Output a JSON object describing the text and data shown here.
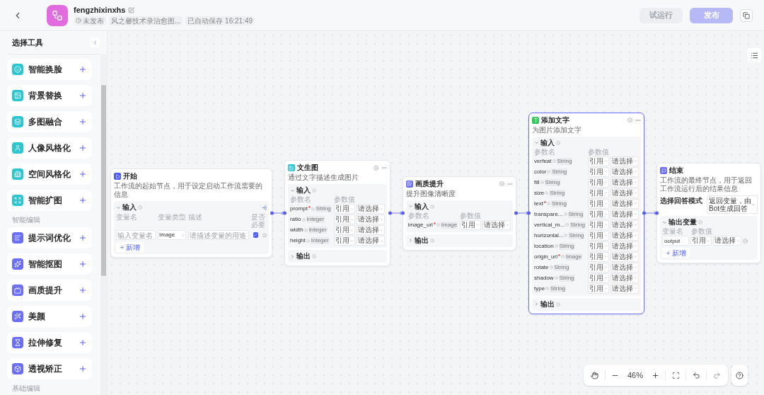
{
  "topbar": {
    "title": "fengzhixinxhs",
    "status": "未发布",
    "description": "风之馨技术录治愈图...",
    "autosave": "已自动保存 16:21:49",
    "buttons": [
      {
        "label": "试运行",
        "kind": "secondary",
        "disabled": true
      },
      {
        "label": "发布",
        "kind": "primary",
        "disabled": true
      }
    ]
  },
  "sidebar": {
    "title": "选择工具",
    "groups": [
      {
        "items": [
          {
            "label": "智能换脸",
            "color": "#2ec5d3"
          },
          {
            "label": "背景替换",
            "color": "#2ec5d3"
          },
          {
            "label": "多图融合",
            "color": "#2ec5d3"
          },
          {
            "label": "人像风格化",
            "color": "#2ec5d3"
          },
          {
            "label": "空间风格化",
            "color": "#2ec5d3"
          },
          {
            "label": "智能扩图",
            "color": "#2ec5d3"
          }
        ]
      },
      {
        "heading": "智能编辑",
        "items": [
          {
            "label": "提示词优化",
            "color": "#6b6ef7"
          },
          {
            "label": "智能抠图",
            "color": "#6b6ef7"
          },
          {
            "label": "画质提升",
            "color": "#6b6ef7"
          },
          {
            "label": "美颜",
            "color": "#6b6ef7"
          },
          {
            "label": "拉伸修复",
            "color": "#6b6ef7"
          },
          {
            "label": "透视矫正",
            "color": "#6b6ef7"
          }
        ]
      },
      {
        "heading": "基础编辑"
      }
    ]
  },
  "canvas": {
    "zoom": "46%",
    "nodes": [
      {
        "kind": "start",
        "title": "开始",
        "color": "#4e5ef5",
        "selected": false,
        "description": "工作流的起始节点，用于设定启动工作流需要的信息",
        "input": {
          "title": "输入",
          "expanded": true,
          "columns": [
            "变量名",
            "变量类型",
            "描述",
            "是否必要"
          ],
          "rows": [
            {
              "name_placeholder": "输入变量名",
              "type": "Image",
              "description_placeholder": "请描述变量的用途",
              "required": true
            }
          ]
        },
        "add_label": "新增"
      },
      {
        "kind": "tool",
        "title": "文生图",
        "color": "#2ec5d3",
        "selected": false,
        "description": "通过文字描述生成图片",
        "input": {
          "title": "输入",
          "expanded": true,
          "columns": [
            "参数名",
            "参数值"
          ],
          "rows": [
            {
              "name": "prompt",
              "required": true,
              "type": "String",
              "source": "引用",
              "value_placeholder": "请选择"
            },
            {
              "name": "ratio",
              "required": false,
              "type": "Integer",
              "source": "引用",
              "value_placeholder": "请选择"
            },
            {
              "name": "width",
              "required": false,
              "type": "Integer",
              "source": "引用",
              "value_placeholder": "请选择"
            },
            {
              "name": "height",
              "required": false,
              "type": "Integer",
              "source": "引用",
              "value_placeholder": "请选择"
            }
          ]
        },
        "output": {
          "title": "输出",
          "expanded": false
        }
      },
      {
        "kind": "tool",
        "title": "画质提升",
        "color": "#6b6ef7",
        "selected": false,
        "description": "提升图像清晰度",
        "input": {
          "title": "输入",
          "expanded": true,
          "columns": [
            "参数名",
            "参数值"
          ],
          "rows": [
            {
              "name": "image_url",
              "required": true,
              "type": "Image",
              "source": "引用",
              "value_placeholder": "请选择"
            }
          ]
        },
        "output": {
          "title": "输出",
          "expanded": false
        }
      },
      {
        "kind": "tool",
        "title": "添加文字",
        "color": "#34c759",
        "selected": true,
        "description": "为图片添加文字",
        "input": {
          "title": "输入",
          "expanded": true,
          "columns": [
            "参数名",
            "参数值"
          ],
          "rows": [
            {
              "name": "verfeat",
              "required": false,
              "type": "String",
              "source": "引用",
              "value_placeholder": "请选择"
            },
            {
              "name": "color",
              "required": false,
              "type": "String",
              "source": "引用",
              "value_placeholder": "请选择"
            },
            {
              "name": "fill",
              "required": false,
              "type": "String",
              "source": "引用",
              "value_placeholder": "请选择"
            },
            {
              "name": "size",
              "required": false,
              "type": "String",
              "source": "引用",
              "value_placeholder": "请选择"
            },
            {
              "name": "text",
              "required": true,
              "type": "String",
              "source": "引用",
              "value_placeholder": "请选择"
            },
            {
              "name": "transpare...",
              "required": false,
              "type": "String",
              "source": "引用",
              "value_placeholder": "请选择"
            },
            {
              "name": "vertical_m...",
              "required": false,
              "type": "String",
              "source": "引用",
              "value_placeholder": "请选择"
            },
            {
              "name": "horizontal...",
              "required": false,
              "type": "String",
              "source": "引用",
              "value_placeholder": "请选择"
            },
            {
              "name": "location",
              "required": false,
              "type": "String",
              "source": "引用",
              "value_placeholder": "请选择"
            },
            {
              "name": "origin_url",
              "required": true,
              "type": "Image",
              "source": "引用",
              "value_placeholder": "请选择"
            },
            {
              "name": "rotate",
              "required": false,
              "type": "String",
              "source": "引用",
              "value_placeholder": "请选择"
            },
            {
              "name": "shadow",
              "required": false,
              "type": "String",
              "source": "引用",
              "value_placeholder": "请选择"
            },
            {
              "name": "type",
              "required": false,
              "type": "String",
              "source": "引用",
              "value_placeholder": "请选择"
            }
          ]
        },
        "output": {
          "title": "输出",
          "expanded": false
        }
      },
      {
        "kind": "end",
        "title": "结束",
        "color": "#6b6ef7",
        "selected": false,
        "description": "工作流的最终节点，用于返回工作流运行后的结果信息",
        "answer_mode": {
          "label": "选择回答模式",
          "value": "返回变量，由Bot生成回答"
        },
        "output": {
          "title": "输出变量",
          "expanded": true,
          "columns": [
            "变量名",
            "参数值"
          ],
          "rows": [
            {
              "name": "output",
              "source": "引用",
              "value_placeholder": "请选择"
            }
          ]
        },
        "add_label": "新增"
      }
    ]
  }
}
